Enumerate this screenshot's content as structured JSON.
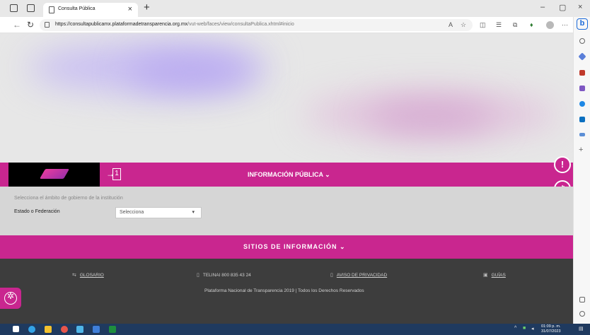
{
  "browser": {
    "tab_title": "Consulta Pública",
    "tab_close": "×",
    "new_tab": "+",
    "url_host": "https://consultapublicamx.plataformadetransparencia.org.mx",
    "url_path": "/vut-web/faces/view/consultaPublica.xhtml#inicio",
    "minimize": "–",
    "restore": "▢",
    "close": "×",
    "back_icon": "arrow-left-icon",
    "refresh_icon": "refresh-icon",
    "bing_label": "b"
  },
  "header": {
    "info_title": "INFORMACIÓN PÚBLICA ⌄",
    "enter_arrow": "→",
    "enter_box": "1",
    "alert_btn": "!",
    "key_btn": "⚷"
  },
  "filter": {
    "hint": "Selecciona el ámbito de gobierno de la institución",
    "label": "Estado o Federación",
    "select_value": "Selecciona",
    "caret": "▾"
  },
  "sites": {
    "title": "SITIOS DE INFORMACIÓN ⌄"
  },
  "footer": {
    "glosario": "GLOSARIO",
    "telinai": "TELINAI 800 835 43 24",
    "aviso": "AVISO DE PRIVACIDAD",
    "guias": "GUÍAS",
    "copyright": "Plataforma Nacional de Transparencia 2019 | Todos los Derechos Reservados"
  },
  "taskbar": {
    "time": "01:09 p. m.",
    "date": "31/07/2023"
  },
  "colors": {
    "brand": "#c9268f",
    "footer": "#3d3d3d",
    "taskbar": "#1f3a5f"
  }
}
